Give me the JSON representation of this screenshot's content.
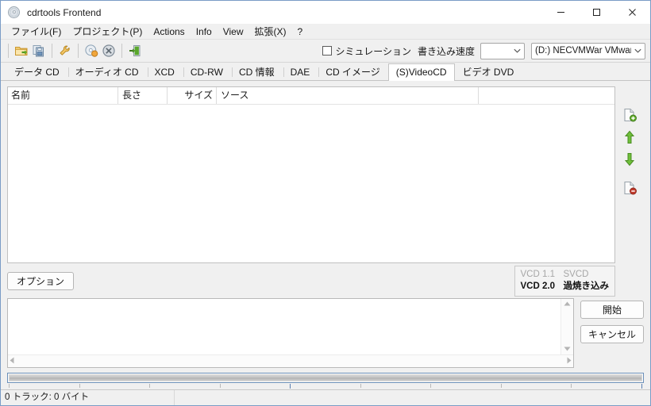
{
  "window": {
    "title": "cdrtools Frontend",
    "icon": "cd-disc-icon",
    "controls": {
      "minimize": "minimize-icon",
      "maximize": "maximize-icon",
      "close": "close-icon"
    }
  },
  "menubar": {
    "items": [
      {
        "label": "ファイル(F)",
        "name": "menu-file"
      },
      {
        "label": "プロジェクト(P)",
        "name": "menu-project"
      },
      {
        "label": "Actions",
        "name": "menu-actions"
      },
      {
        "label": "Info",
        "name": "menu-info"
      },
      {
        "label": "View",
        "name": "menu-view"
      },
      {
        "label": "拡張(X)",
        "name": "menu-extensions"
      },
      {
        "label": "?",
        "name": "menu-help"
      }
    ]
  },
  "toolbar": {
    "buttons": [
      {
        "name": "open-project-icon"
      },
      {
        "name": "copy-disc-icon"
      },
      {
        "name": "tools-wrench-icon"
      },
      {
        "name": "burn-disc-icon"
      },
      {
        "name": "cancel-disc-icon"
      },
      {
        "name": "exit-door-icon"
      }
    ],
    "simulation": {
      "label": "シミュレーション",
      "checked": false
    },
    "speed_label": "書き込み速度",
    "speed_value": "",
    "device_value": "(D:) NECVMWar VMware",
    "dropdown_arrow": "chevron-down-icon"
  },
  "tabs": [
    {
      "label": "データ CD",
      "active": false
    },
    {
      "label": "オーディオ CD",
      "active": false
    },
    {
      "label": "XCD",
      "active": false
    },
    {
      "label": "CD-RW",
      "active": false
    },
    {
      "label": "CD 情報",
      "active": false
    },
    {
      "label": "DAE",
      "active": false
    },
    {
      "label": "CD イメージ",
      "active": false
    },
    {
      "label": "(S)VideoCD",
      "active": true
    },
    {
      "label": "ビデオ DVD",
      "active": false
    }
  ],
  "listview": {
    "columns": [
      "名前",
      "長さ",
      "サイズ",
      "ソース"
    ],
    "rows": []
  },
  "side_buttons": [
    {
      "name": "add-file-icon"
    },
    {
      "name": "move-up-icon"
    },
    {
      "name": "move-down-icon"
    },
    {
      "name": "remove-file-icon"
    }
  ],
  "options_button": "オプション",
  "vcd_info": {
    "row1": {
      "left": "VCD 1.1",
      "right": "SVCD",
      "left_active": false,
      "right_active": false
    },
    "row2": {
      "left": "VCD 2.0",
      "right": "過焼き込み",
      "left_active": true,
      "right_active": true
    }
  },
  "log": {
    "text": ""
  },
  "actions": {
    "start": "開始",
    "cancel": "キャンセル"
  },
  "progress": {
    "percent": 0
  },
  "statusbar": {
    "left": "0 トラック: 0 バイト",
    "right": ""
  },
  "colors": {
    "accent_border": "#7a9cc6",
    "green": "#5faa28",
    "orange": "#e8a33d",
    "red": "#c0392b",
    "window_bg": "#f0f0f0"
  }
}
